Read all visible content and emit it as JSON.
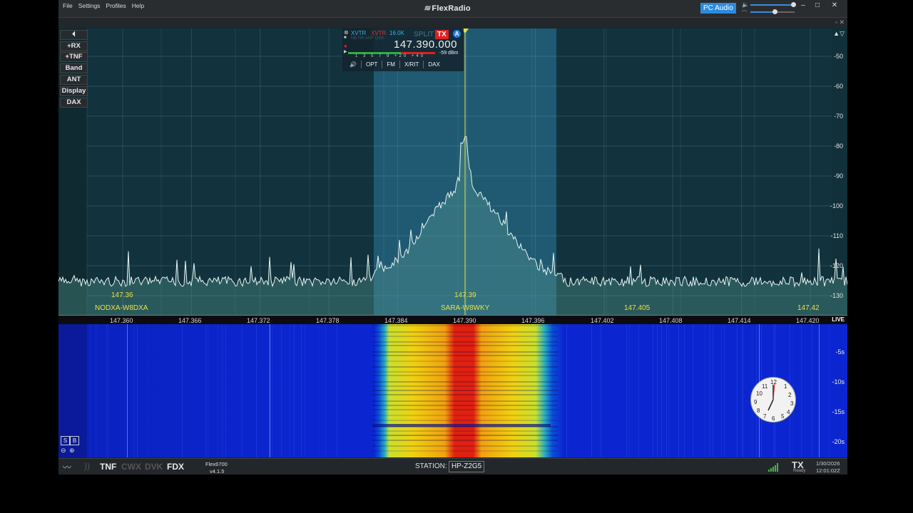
{
  "menu": [
    "File",
    "Settings",
    "Profiles",
    "Help"
  ],
  "app_title": "FlexRadio",
  "pc_audio": "PC Audio",
  "window_controls": {
    "min": "–",
    "max": "□",
    "close": "✕"
  },
  "audio": {
    "tx_volume_fraction": 0.97,
    "headphone_volume_fraction": 0.55
  },
  "side_buttons": [
    "+RX",
    "+TNF",
    "Band",
    "ANT",
    "Display",
    "DAX"
  ],
  "dbm_scale": [
    "-50",
    "-60",
    "-70",
    "-80",
    "-90",
    "-100",
    "-110",
    "-120",
    "-130"
  ],
  "slice": {
    "xvtr_primary": "XVTR",
    "xvtr_secondary": "XVTR",
    "bandwidth": "16.0K",
    "sub_text": "NB NR ANF QSK",
    "split_label": "SPLIT",
    "tx_label": "TX",
    "slice_letter": "A",
    "frequency": "147.390.000",
    "signal": "-59 dBm",
    "meter_scale": "1 3 5 7 9 +20 +40",
    "meter_fraction": 0.61,
    "buttons": [
      "OPT",
      "FM",
      "X/RIT",
      "DAX"
    ]
  },
  "spots": [
    {
      "freq": "147.36",
      "call": "NODXA-W8DXA"
    },
    {
      "freq": "147.39",
      "call": "SARA-W8WKY"
    },
    {
      "freq": "147.405",
      "call": ""
    },
    {
      "freq": "147.42",
      "call": ""
    }
  ],
  "ruler": [
    "147.360",
    "147.366",
    "147.372",
    "147.378",
    "147.384",
    "147.390",
    "147.396",
    "147.402",
    "147.408",
    "147.414",
    "147.420"
  ],
  "live_label": "LIVE",
  "waterfall_times": [
    "-5s",
    "-10s",
    "-15s",
    "-20s"
  ],
  "wf_buttons": {
    "s": "S",
    "b": "B"
  },
  "status": {
    "tnf": "TNF",
    "cwx": "CWX",
    "dvk": "DVK",
    "fdx": "FDX",
    "radio_model": "Flex6700",
    "radio_version": "v4.1.5",
    "station_label": "STATION:",
    "station_name": "HP-Z2G5",
    "tx": "TX",
    "tx_state": "Ready",
    "date": "1/30/2026",
    "time": "12:01:02Z"
  },
  "colors": {
    "accent": "#2a8be0",
    "tx_red": "#e02020",
    "spot_yellow": "#e8e046",
    "trace": "#e8f4f4"
  }
}
